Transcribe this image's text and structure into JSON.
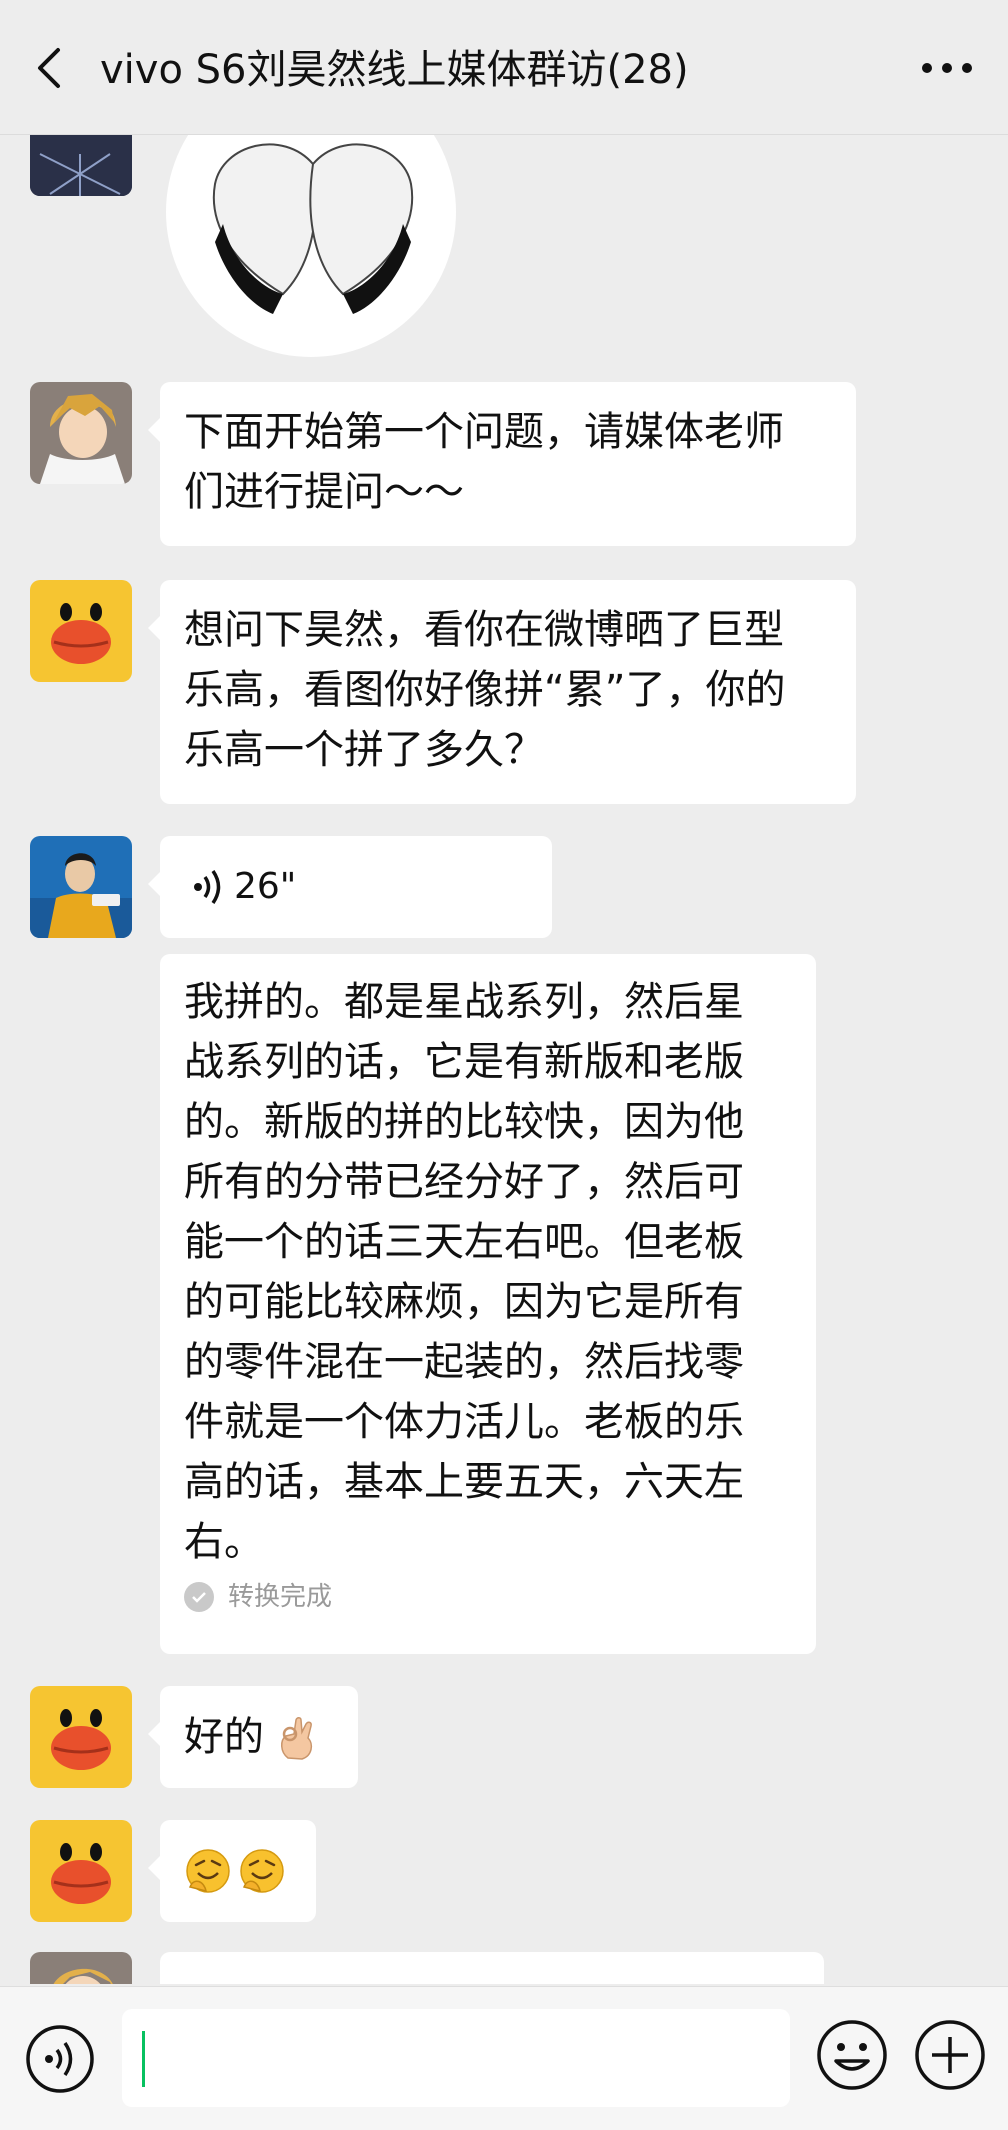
{
  "header": {
    "title": "vivo S6刘昊然线上媒体群访(28)",
    "back_icon": "chevron-left-icon",
    "more_icon": "ellipsis-icon"
  },
  "messages": [
    {
      "type": "sticker",
      "content": "hands-heart-sticker"
    },
    {
      "type": "text",
      "avatar": "anime-boy-avatar",
      "text_lines": [
        "下面开始第一个问题，请媒体老师",
        "们进行提问～～"
      ]
    },
    {
      "type": "text",
      "avatar": "yellow-duck-avatar",
      "text_lines": [
        "想问下昊然，看你在微博晒了巨型",
        "乐高，看图你好像拼“累”了，你的",
        "乐高一个拼了多久？"
      ]
    },
    {
      "type": "voice",
      "avatar": "man-yellow-jacket-avatar",
      "duration": "26\""
    },
    {
      "type": "transcript",
      "text_lines": [
        "我拼的。都是星战系列，然后星",
        "战系列的话，它是有新版和老版",
        "的。新版的拼的比较快，因为他",
        "所有的分带已经分好了，然后可",
        "能一个的话三天左右吧。但老板",
        "的可能比较麻烦，因为它是所有",
        "的零件混在一起装的，然后找零",
        "件就是一个体力活儿。老板的乐",
        "高的话，基本上要五天，六天左",
        "右。"
      ],
      "status": "转换完成"
    },
    {
      "type": "text",
      "avatar": "yellow-duck-avatar",
      "text": "好的",
      "emoji": "ok-hand-emoji"
    },
    {
      "type": "emoji",
      "avatar": "yellow-duck-avatar",
      "emoji": "thinking-emoji"
    }
  ],
  "input": {
    "value": "",
    "placeholder": ""
  },
  "colors": {
    "background": "#ededed",
    "bubble": "#ffffff",
    "caret": "#07c160",
    "duck_yellow": "#f6c531",
    "duck_mouth": "#e8502c"
  }
}
